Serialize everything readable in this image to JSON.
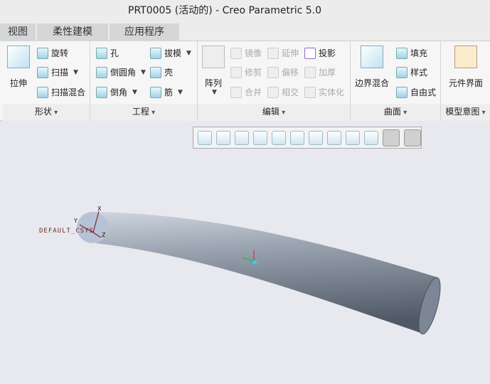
{
  "title": "PRT0005 (活动的) - Creo Parametric 5.0",
  "tabs": [
    "视图",
    "柔性建模",
    "应用程序"
  ],
  "groups": {
    "shape": {
      "label": "形状",
      "extrude": "拉伸",
      "revolve": "旋转",
      "sweep": "扫描",
      "swept_blend": "扫描混合"
    },
    "engineering": {
      "label": "工程",
      "hole": "孔",
      "round": "倒圆角",
      "chamfer": "倒角",
      "draft": "拔模",
      "shell": "壳",
      "rib": "筋"
    },
    "editing": {
      "label": "编辑",
      "pattern": "阵列",
      "mirror": "镜像",
      "trim": "修剪",
      "merge": "合并",
      "extend": "延伸",
      "offset": "偏移",
      "intersect": "相交",
      "project": "投影",
      "thicken": "加厚",
      "solidify": "实体化"
    },
    "surfaces": {
      "label": "曲面",
      "boundary_blend": "边界混合",
      "fill": "填充",
      "style": "样式",
      "freestyle": "自由式"
    },
    "model_intent": {
      "label": "模型意图",
      "component_interface": "元件界面"
    }
  },
  "viewport": {
    "csys_label": "DEFAULT_CSYS",
    "axes": {
      "x": "X",
      "y": "Y",
      "z": "Z"
    },
    "background": "#e8e9ee",
    "part_color": "#8b95a3"
  }
}
